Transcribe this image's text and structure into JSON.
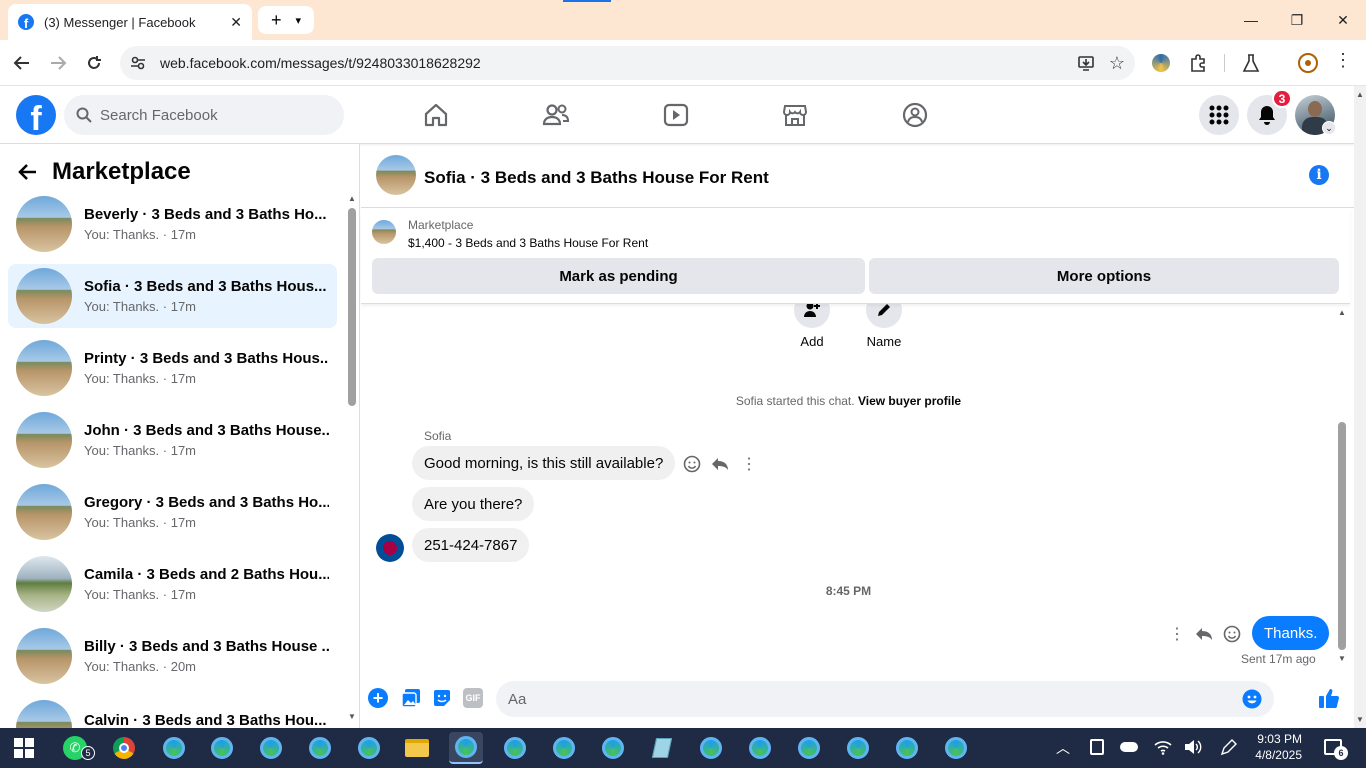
{
  "browser": {
    "tab_title": "(3) Messenger | Facebook",
    "url": "web.facebook.com/messages/t/9248033018628292"
  },
  "facebook": {
    "search_placeholder": "Search Facebook",
    "notification_count": "3"
  },
  "sidebar": {
    "title": "Marketplace",
    "conversations": [
      {
        "name": "Beverly · 3 Beds and 3 Baths Ho...",
        "last": "You: Thanks. · 17m"
      },
      {
        "name": "Sofia · 3 Beds and 3 Baths Hous...",
        "last": "You: Thanks. · 17m"
      },
      {
        "name": "Printy · 3 Beds and 3 Baths Hous...",
        "last": "You: Thanks. · 17m"
      },
      {
        "name": "John · 3 Beds and 3 Baths House...",
        "last": "You: Thanks. · 17m"
      },
      {
        "name": "Gregory · 3 Beds and 3 Baths Ho...",
        "last": "You: Thanks. · 17m"
      },
      {
        "name": "Camila · 3 Beds and 2 Baths Hou...",
        "last": "You: Thanks. · 17m"
      },
      {
        "name": "Billy · 3 Beds and 3 Baths House ...",
        "last": "You: Thanks. · 20m"
      },
      {
        "name": "Calvin · 3 Beds and 3 Baths Hou...",
        "last": ""
      }
    ]
  },
  "chat": {
    "title": "Sofia · 3 Beds and 3 Baths House For Rent",
    "marketplace_label": "Marketplace",
    "listing": "$1,400 - 3 Beds and 3 Baths House For Rent",
    "mark_pending": "Mark as pending",
    "more_options": "More options",
    "add_label": "Add",
    "name_label": "Name",
    "started_text": "Sofia started this chat.",
    "view_profile": "View buyer profile",
    "sender": "Sofia",
    "messages_in": [
      "Good morning, is this still available?",
      "Are you there?",
      "251-424-7867"
    ],
    "timestamp": "8:45 PM",
    "message_out": "Thanks.",
    "sent_status": "Sent 17m ago",
    "composer_placeholder": "Aa",
    "gif_label": "GIF"
  },
  "taskbar": {
    "whatsapp_badge": "5",
    "time": "9:03 PM",
    "date": "4/8/2025",
    "notifications": "6"
  },
  "colors": {
    "fb_blue": "#1877f2",
    "messenger_blue": "#0a7cff",
    "tab_bg": "#fde7d3",
    "taskbar": "#1f2a44"
  }
}
